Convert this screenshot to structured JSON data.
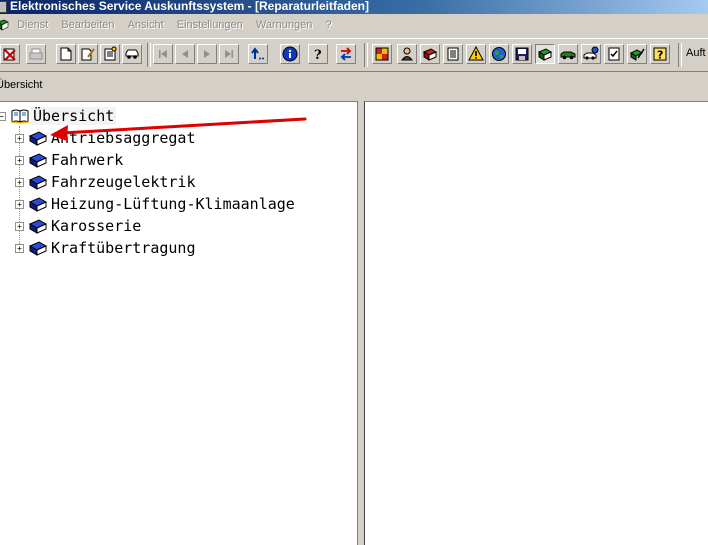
{
  "window": {
    "title": "Elektronisches Service Auskunftssystem - [Reparaturleitfaden]"
  },
  "menu": {
    "items": [
      "Dienst",
      "Bearbeiten",
      "Ansicht",
      "Einstellungen",
      "Warnungen",
      "?"
    ]
  },
  "toolbar": {
    "overflow_text": "Auft",
    "buttons": [
      "close-icon",
      "print-icon",
      "new-document-icon",
      "edit-document-icon",
      "notes-icon",
      "car-icon",
      "first-icon",
      "previous-icon",
      "next-icon",
      "last-icon",
      "jump-back-icon",
      "info-icon",
      "help-icon",
      "swap-icon",
      "grid-icon",
      "person-icon",
      "book-red-icon",
      "list-icon",
      "warning-icon",
      "globe-icon",
      "save-icon",
      "book-green-icon",
      "vehicle-icon",
      "diagnosis-icon",
      "checklist-icon",
      "edit-icon",
      "question-icon"
    ]
  },
  "address": {
    "current": "Übersicht"
  },
  "tree": {
    "root": {
      "label": "Übersicht",
      "icon": "open-book-icon",
      "expander": "−"
    },
    "items": [
      {
        "label": "Antriebsaggregat",
        "icon": "book-icon",
        "expander": "+"
      },
      {
        "label": "Fahrwerk",
        "icon": "book-icon",
        "expander": "+"
      },
      {
        "label": "Fahrzeugelektrik",
        "icon": "book-icon",
        "expander": "+"
      },
      {
        "label": "Heizung-Lüftung-Klimaanlage",
        "icon": "book-icon",
        "expander": "+"
      },
      {
        "label": "Karosserie",
        "icon": "book-icon",
        "expander": "+"
      },
      {
        "label": "Kraftübertragung",
        "icon": "book-icon",
        "expander": "+"
      }
    ]
  },
  "annotation": {
    "arrow_color": "#e00000"
  }
}
